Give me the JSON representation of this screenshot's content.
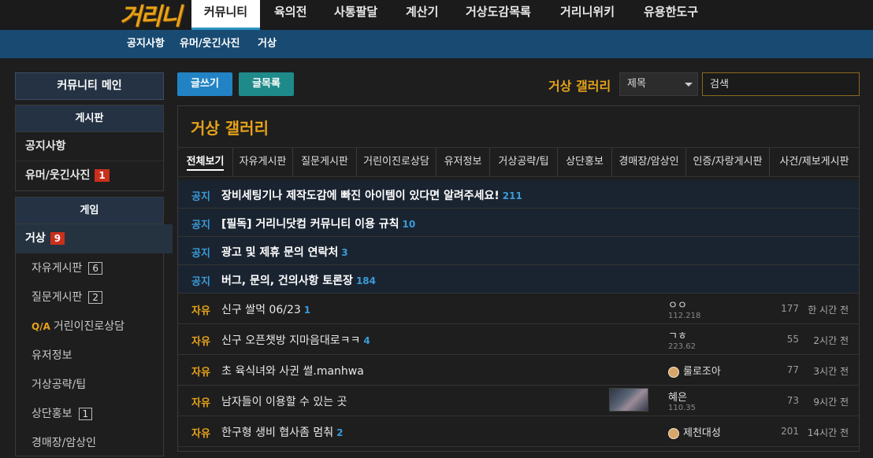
{
  "topnav": {
    "logo_text": "거리니",
    "items": [
      {
        "label": "커뮤니티",
        "active": true
      },
      {
        "label": "육의전"
      },
      {
        "label": "사통팔달"
      },
      {
        "label": "계산기"
      },
      {
        "label": "거상도감목록"
      },
      {
        "label": "거리니위키"
      },
      {
        "label": "유용한도구"
      }
    ]
  },
  "subnav": {
    "items": [
      "공지사항",
      "유머/웃긴사진",
      "거상"
    ]
  },
  "sidebar": {
    "main_button": "커뮤니티 메인",
    "board_section": {
      "header": "게시판",
      "items": [
        {
          "label": "공지사항"
        },
        {
          "label": "유머/웃긴사진",
          "badge": "1"
        }
      ]
    },
    "game_section": {
      "header": "게임",
      "selected": {
        "label": "거상",
        "badge": "9"
      },
      "items": [
        {
          "label": "자유게시판",
          "badge": "6"
        },
        {
          "label": "질문게시판",
          "badge": "2"
        },
        {
          "prefix": "Q/A",
          "label": "거린이진로상담"
        },
        {
          "label": "유저정보"
        },
        {
          "label": "거상공략/팁"
        },
        {
          "label": "상단홍보",
          "badge": "1"
        },
        {
          "label": "경매장/암상인"
        }
      ]
    }
  },
  "toolbar": {
    "write_label": "글쓰기",
    "list_label": "글목록",
    "gallery_label": "거상 갤러리",
    "search_select_value": "제목",
    "search_placeholder": "검색"
  },
  "board": {
    "title": "거상 갤러리",
    "tabs": [
      {
        "label": "전체보기",
        "active": true
      },
      {
        "label": "자유게시판"
      },
      {
        "label": "질문게시판"
      },
      {
        "label": "거린이진로상담"
      },
      {
        "label": "유저정보"
      },
      {
        "label": "거상공략/팁"
      },
      {
        "label": "상단홍보"
      },
      {
        "label": "경매장/암상인"
      },
      {
        "label": "인증/자랑게시판"
      },
      {
        "label": "사건/제보게시판"
      }
    ],
    "notices": [
      {
        "category": "공지",
        "title": "장비세팅기나 제작도감에 빠진 아이템이 있다면 알려주세요!",
        "comments": "211"
      },
      {
        "category": "공지",
        "title": "[필독] 거리니닷컴 커뮤니티 이용 규칙",
        "comments": "10"
      },
      {
        "category": "공지",
        "title": "광고 및 제휴 문의 연락처",
        "comments": "3"
      },
      {
        "category": "공지",
        "title": "버그, 문의, 건의사항 토론장",
        "comments": "184"
      }
    ],
    "posts": [
      {
        "category": "자유",
        "title": "신구 쌀먹 06/23",
        "comments": "1",
        "author": "ㅇㅇ",
        "ip": "112.218",
        "views": "177",
        "time": "한 시간 전"
      },
      {
        "category": "자유",
        "title": "신구 오픈챗방 지마음대로ㅋㅋ",
        "comments": "4",
        "author": "ㄱㅎ",
        "ip": "223.62",
        "views": "55",
        "time": "2시간 전"
      },
      {
        "category": "자유",
        "title": "초 육식녀와 사귄 썰.manhwa",
        "comments": "",
        "author": "룰로조아",
        "ip": "",
        "views": "77",
        "time": "3시간 전",
        "avatar": true
      },
      {
        "category": "자유",
        "title": "남자들이 이용할 수 있는 곳",
        "comments": "",
        "author": "혜은",
        "ip": "110.35",
        "views": "73",
        "time": "9시간 전",
        "thumbnail": true
      },
      {
        "category": "자유",
        "title": "한구형 생비 협사좀 멈춰",
        "comments": "2",
        "author": "제천대성",
        "ip": "",
        "views": "201",
        "time": "14시간 전",
        "avatar": true
      }
    ]
  },
  "colors": {
    "accent_gold": "#e6a21a",
    "subnav_blue": "#184a72",
    "notice_blue": "#3a9bd9",
    "write_button": "#2183c4",
    "list_button": "#1f8a8a",
    "badge_red": "#c9301c"
  }
}
